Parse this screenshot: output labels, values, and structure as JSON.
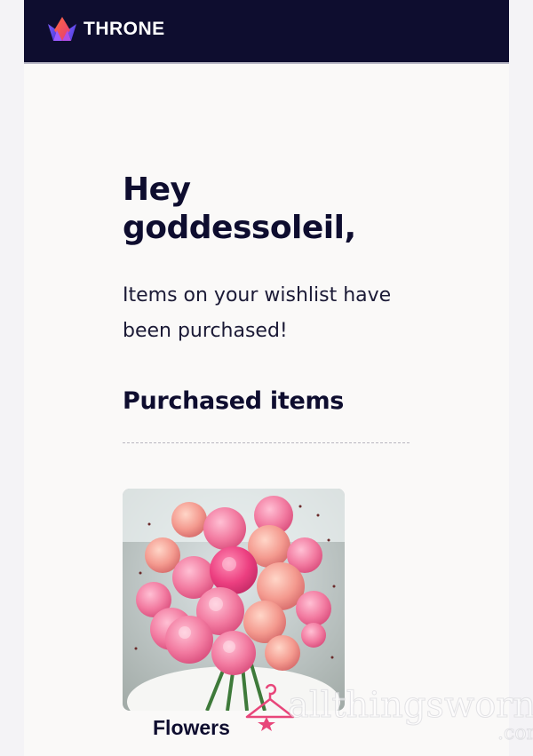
{
  "header": {
    "brand": "THRONE",
    "logo_icon": "crown-logo-icon",
    "background": "#0e0d2f"
  },
  "greeting": {
    "line1": "Hey",
    "line2": "goddessoleil,"
  },
  "message": "Items on your wishlist have been purchased!",
  "section": {
    "title": "Purchased items"
  },
  "items": [
    {
      "name": "Flowers",
      "image": "pink-flower-bouquet"
    }
  ],
  "watermark": {
    "text": "allthingsworn",
    "suffix": ".com",
    "icon": "hanger-icon"
  }
}
